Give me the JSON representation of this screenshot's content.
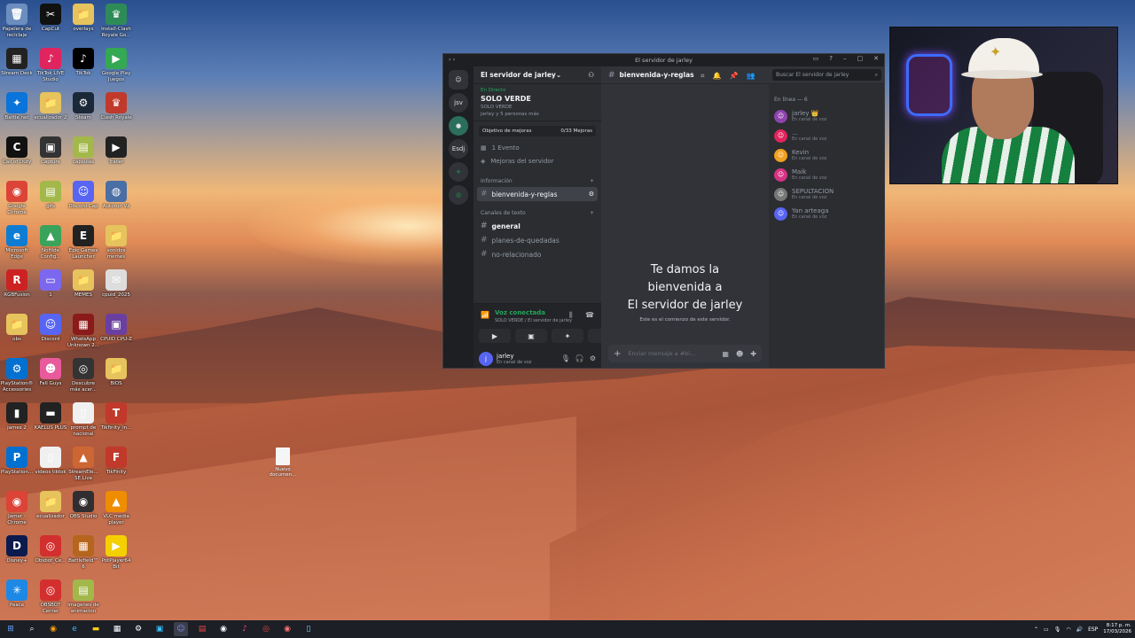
{
  "desktop": {
    "icons": [
      {
        "label": "Papelera de reciclaje",
        "glyph": "🗑",
        "color": "#6c8ebf"
      },
      {
        "label": "CapCut",
        "glyph": "✂",
        "color": "#111111"
      },
      {
        "label": "overlays",
        "glyph": "📁",
        "color": "#e6c35c"
      },
      {
        "label": "Install-Clash Royale Go...",
        "glyph": "♛",
        "color": "#2e8b57"
      },
      {
        "label": "Stream Deck",
        "glyph": "▦",
        "color": "#222222"
      },
      {
        "label": "TikTok LIVE Studio",
        "glyph": "♪",
        "color": "#e0245e"
      },
      {
        "label": "TikTok",
        "glyph": "♪",
        "color": "#000000"
      },
      {
        "label": "Google Play Juegos",
        "glyph": "▶",
        "color": "#34a853"
      },
      {
        "label": "Battle.net",
        "glyph": "✦",
        "color": "#0a74da"
      },
      {
        "label": "ecualizador 2",
        "glyph": "📁",
        "color": "#e6c35c"
      },
      {
        "label": "Steam",
        "glyph": "⚙",
        "color": "#1b2838"
      },
      {
        "label": "Clash Royale",
        "glyph": "♛",
        "color": "#c0392b"
      },
      {
        "label": "Call of Duty",
        "glyph": "C",
        "color": "#111111"
      },
      {
        "label": "Capture",
        "glyph": "▣",
        "color": "#333333"
      },
      {
        "label": "capsulas",
        "glyph": "▤",
        "color": "#a3b84a"
      },
      {
        "label": "Trailer",
        "glyph": "▶",
        "color": "#222222"
      },
      {
        "label": "Google Chrome",
        "glyph": "◉",
        "color": "#db4437"
      },
      {
        "label": "gifs",
        "glyph": "▤",
        "color": "#a3b84a"
      },
      {
        "label": "Discord-Cap",
        "glyph": "☺",
        "color": "#5865f2"
      },
      {
        "label": "Autorun Vz",
        "glyph": "◍",
        "color": "#4a6fa5"
      },
      {
        "label": "Microsoft Edge",
        "glyph": "e",
        "color": "#0f7cd4"
      },
      {
        "label": "NoHide Config...",
        "glyph": "▲",
        "color": "#3aa35b"
      },
      {
        "label": "Epic Games Launcher",
        "glyph": "E",
        "color": "#222222"
      },
      {
        "label": "sonidos memes",
        "glyph": "📁",
        "color": "#e6c35c"
      },
      {
        "label": "RGBFusion",
        "glyph": "R",
        "color": "#cc2222"
      },
      {
        "label": "1",
        "glyph": "▭",
        "color": "#7b68ee"
      },
      {
        "label": "MEMES",
        "glyph": "📁",
        "color": "#e6c35c"
      },
      {
        "label": "cpuid_2025",
        "glyph": "✉",
        "color": "#dddddd"
      },
      {
        "label": "obs",
        "glyph": "📁",
        "color": "#e6c35c"
      },
      {
        "label": "Discord",
        "glyph": "☺",
        "color": "#5865f2"
      },
      {
        "label": "WhatsApp Unknown 2...",
        "glyph": "▦",
        "color": "#8b1a1a"
      },
      {
        "label": "CPUID CPU-Z",
        "glyph": "▣",
        "color": "#6a3fa0"
      },
      {
        "label": "PlayStation® Accessories",
        "glyph": "⚙",
        "color": "#0070d1"
      },
      {
        "label": "Fall Guys",
        "glyph": "☻",
        "color": "#e85a9b"
      },
      {
        "label": "Descubre más acer...",
        "glyph": "◎",
        "color": "#333333"
      },
      {
        "label": "BIOS",
        "glyph": "📁",
        "color": "#e6c35c"
      },
      {
        "label": "james 2",
        "glyph": "▮",
        "color": "#222222"
      },
      {
        "label": "KAELUS PLUS",
        "glyph": "▬",
        "color": "#222222"
      },
      {
        "label": "prompt de nacional",
        "glyph": "▯",
        "color": "#f0f0f0"
      },
      {
        "label": "Tikfinity_in...",
        "glyph": "T",
        "color": "#c0392b"
      },
      {
        "label": "PlayStation...",
        "glyph": "P",
        "color": "#0070d1"
      },
      {
        "label": "videos tiktok",
        "glyph": "▯",
        "color": "#f0f0f0"
      },
      {
        "label": "StreamEle... SE.Live",
        "glyph": "▲",
        "color": "#cc6633"
      },
      {
        "label": "TikFinity",
        "glyph": "F",
        "color": "#c0392b"
      },
      {
        "label": "Jamer - Chrome",
        "glyph": "◉",
        "color": "#db4437"
      },
      {
        "label": "ecualizador",
        "glyph": "📁",
        "color": "#e6c35c"
      },
      {
        "label": "OBS Studio",
        "glyph": "◉",
        "color": "#302e31"
      },
      {
        "label": "VLC media player",
        "glyph": "▲",
        "color": "#f08c00"
      },
      {
        "label": "Disney+",
        "glyph": "D",
        "color": "#0b1b4d"
      },
      {
        "label": "Obsbot_Ce...",
        "glyph": "◎",
        "color": "#d32f2f"
      },
      {
        "label": "Battlefield™ 6",
        "glyph": "▦",
        "color": "#b5651d"
      },
      {
        "label": "PotPlayer64 Bit",
        "glyph": "▶",
        "color": "#f5d000"
      },
      {
        "label": "Peace",
        "glyph": "✳",
        "color": "#1e88e5"
      },
      {
        "label": "OBSBOT Center",
        "glyph": "◎",
        "color": "#d32f2f"
      },
      {
        "label": "imagenes de animacion",
        "glyph": "▤",
        "color": "#a3b84a"
      }
    ],
    "new_file_label": "Nuevo documen..."
  },
  "window": {
    "title": "El servidor de jarley",
    "servers": [
      "jsv",
      "Esdj"
    ],
    "server_name": "El servidor de jarley",
    "live": {
      "status": "En Directo",
      "title": "SOLO VERDE",
      "game": "SOLO VERDE",
      "watchers": "jarley y 5 personas más"
    },
    "goal": {
      "label": "Objetivo de mejoras",
      "value": "0/33 Mejoras"
    },
    "events": "1 Evento",
    "boosts": "Mejoras del servidor",
    "categories": {
      "info": "Información",
      "text": "Canales de texto"
    },
    "channels": {
      "welcome": "bienvenida-y-reglas",
      "general": "general",
      "plans": "planes-de-quedadas",
      "unrelated": "no-relacionado"
    },
    "voice": {
      "status": "Voz conectada",
      "location": "SOLO VERDE / El servidor de jarley"
    },
    "user": {
      "name": "jarley",
      "status": "En canal de voz"
    },
    "header_channel": "bienvenida-y-reglas",
    "welcome": {
      "line1": "Te damos la",
      "line2": "bienvenida a",
      "line3": "El servidor de jarley",
      "sub": "Este es el comienzo de este servidor."
    },
    "message_placeholder": "Enviar mensaje a #bi...",
    "search_placeholder": "Buscar El servidor de jarley",
    "members_title": "En línea — 6",
    "members": [
      {
        "name": "jarley 👑",
        "status": "En canal de voz",
        "color": "#8e44ad"
      },
      {
        "name": "...",
        "status": "En canal de voz",
        "color": "#e0245e"
      },
      {
        "name": "Kevin",
        "status": "En canal de voz",
        "color": "#f0a020"
      },
      {
        "name": "Maik",
        "status": "En canal de voz",
        "color": "#d63384"
      },
      {
        "name": "SEPULTACION",
        "status": "En canal de voz",
        "color": "#777777"
      },
      {
        "name": "Yan arteaga",
        "status": "En canal de voz",
        "color": "#5865f2"
      }
    ]
  },
  "taskbar": {
    "language": "ESP",
    "time": "8:17 p. m.",
    "date": "17/03/2026"
  }
}
